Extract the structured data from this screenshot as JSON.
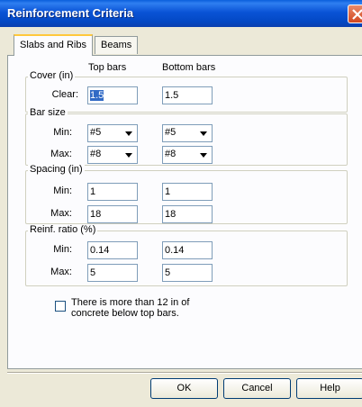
{
  "window": {
    "title": "Reinforcement Criteria"
  },
  "tabs": [
    {
      "label": "Slabs and Ribs"
    },
    {
      "label": "Beams"
    }
  ],
  "columns": {
    "top": "Top bars",
    "bottom": "Bottom bars"
  },
  "cover": {
    "title": "Cover (in)",
    "clear": {
      "label": "Clear:",
      "top": "1.5",
      "bottom": "1.5"
    }
  },
  "bar_size": {
    "title": "Bar size",
    "min": {
      "label": "Min:",
      "top": "#5",
      "bottom": "#5"
    },
    "max": {
      "label": "Max:",
      "top": "#8",
      "bottom": "#8"
    }
  },
  "spacing": {
    "title": "Spacing (in)",
    "min": {
      "label": "Min:",
      "top": "1",
      "bottom": "1"
    },
    "max": {
      "label": "Max:",
      "top": "18",
      "bottom": "18"
    }
  },
  "reinf_ratio": {
    "title": "Reinf. ratio (%)",
    "min": {
      "label": "Min:",
      "top": "0.14",
      "bottom": "0.14"
    },
    "max": {
      "label": "Max:",
      "top": "5",
      "bottom": "5"
    }
  },
  "checkbox": {
    "label": "There is more than 12 in of concrete below top bars.",
    "checked": false
  },
  "buttons": {
    "ok": "OK",
    "cancel": "Cancel",
    "help": "Help"
  },
  "colors": {
    "titlebar": "#0a53d6",
    "dialog_bg": "#ece9d8",
    "selection": "#316ac5"
  },
  "icons": {
    "close": "close-icon",
    "dropdown": "chevron-down-icon"
  }
}
